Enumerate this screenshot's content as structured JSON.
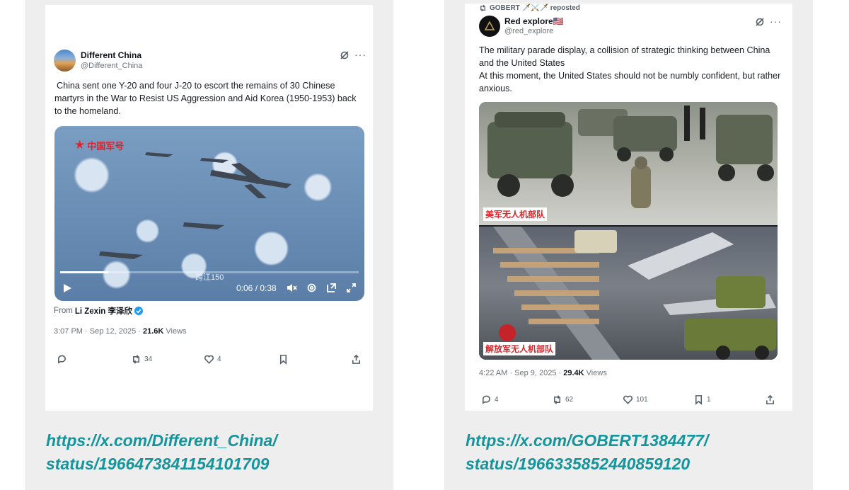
{
  "posts": [
    {
      "author_name": "Different China",
      "author_handle": "@Different_China",
      "text": "China sent one Y-20 and four J-20 to escort the remains of 30 Chinese martyrs in the War to Resist US Aggression and Aid Korea (1950-1953) back to the homeland.",
      "video_overlay_label": "中国军号",
      "video_watermark": "跨江150",
      "video_time": "0:06 / 0:38",
      "video_progress": 0.16,
      "from_prefix": "From",
      "from_name": "Li Zexin 李泽欣",
      "timestamp": "3:07 PM · Sep 12, 2025 ·",
      "views_count": "21.6K",
      "views_label": "Views",
      "reposts": "34",
      "likes": "4",
      "source_url_line1": "https://x.com/Different_China/",
      "source_url_line2": "status/1966473841154101709"
    },
    {
      "repost_note": "GOBERT 🗡️⚔️🗡️ reposted",
      "author_name": "Red explore🇺🇸",
      "author_handle": "@red_explore",
      "text_line1": "The military parade display, a collision of strategic thinking between China and the United States",
      "text_line2": "At this moment, the United States should not be numbly confident, but rather anxious.",
      "image_caption_top": "美军无人机部队",
      "image_caption_bottom": "解放军无人机部队",
      "timestamp": "4:22 AM · Sep 9, 2025 ·",
      "views_count": "29.4K",
      "views_label": "Views",
      "replies": "4",
      "reposts": "62",
      "likes": "101",
      "bookmarks": "1",
      "source_url_line1": "https://x.com/GOBERT1384477/",
      "source_url_line2": "status/1966335852440859120"
    }
  ],
  "colors": {
    "panel_bg": "#eeeeef",
    "url_teal": "#14959c",
    "verified_blue": "#1d9bf0",
    "caption_red": "#e0242a"
  }
}
